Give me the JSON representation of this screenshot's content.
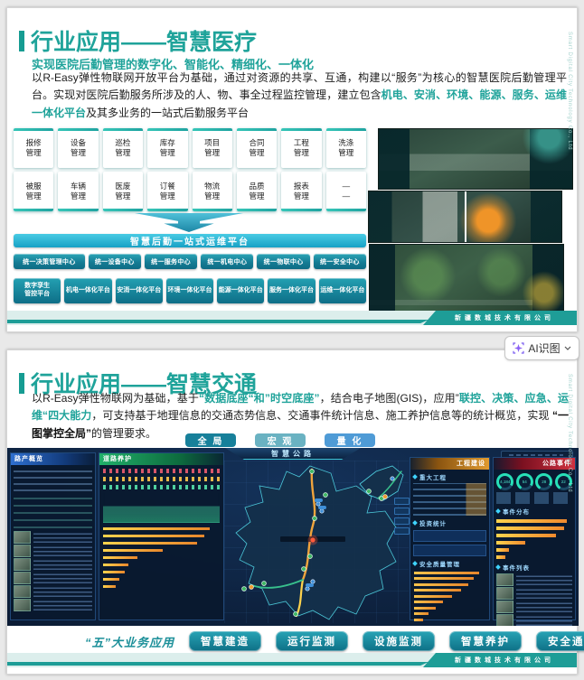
{
  "ai_button": {
    "label": "AI识图"
  },
  "footer": {
    "company": "新疆数城技术有限公司",
    "side_text": "Smart Digital City Technology Co., Ltd"
  },
  "colors": {
    "accent_teal": "#1fa39a",
    "cyan_bar": "#2cb7d6",
    "button_teal": "#147e96",
    "dashboard_bg": "#0b1c35",
    "header_blue": "#2e6fd0",
    "header_green": "#21b06a",
    "header_orange": "#e09a2e",
    "header_red": "#d0313f"
  },
  "slide1": {
    "title": "行业应用——智慧医疗",
    "subtitle": "实现医院后勤管理的数字化、智能化、精细化、一体化",
    "body": {
      "seg1": "以R-Easy弹性物联网开放平台为基础，通过对资源的共享、互通，构建以“服务”为核心的智慧医院后勤管理平台。实现对医院后勤服务所涉及的人、物、事全过程监控管理，建立包含",
      "hl": "机电、安消、环境、能源、服务、运维一体化平台",
      "seg2": "及其多业务的一站式后勤服务平台"
    },
    "modules": {
      "row1": [
        {
          "l1": "报修",
          "l2": "管理"
        },
        {
          "l1": "设备",
          "l2": "管理"
        },
        {
          "l1": "巡检",
          "l2": "管理"
        },
        {
          "l1": "库存",
          "l2": "管理"
        },
        {
          "l1": "项目",
          "l2": "管理"
        },
        {
          "l1": "合同",
          "l2": "管理"
        },
        {
          "l1": "工程",
          "l2": "管理"
        },
        {
          "l1": "洗涤",
          "l2": "管理"
        }
      ],
      "row2": [
        {
          "l1": "被服",
          "l2": "管理"
        },
        {
          "l1": "车辆",
          "l2": "管理"
        },
        {
          "l1": "医废",
          "l2": "管理"
        },
        {
          "l1": "订餐",
          "l2": "管理"
        },
        {
          "l1": "物流",
          "l2": "管理"
        },
        {
          "l1": "品质",
          "l2": "管理"
        },
        {
          "l1": "报表",
          "l2": "管理"
        },
        {
          "l1": "—",
          "l2": "—"
        }
      ]
    },
    "funnel_bar": "智慧后勤一站式运维平台",
    "centers": [
      "统一决策管理中心",
      "统一设备中心",
      "统一服务中心",
      "统一机电中心",
      "统一物联中心",
      "统一安全中心"
    ],
    "platforms": [
      {
        "l1": "数字孪生",
        "l2": "管控平台"
      },
      {
        "l1": "机电一体化平台",
        "l2": ""
      },
      {
        "l1": "安消一体化平台",
        "l2": ""
      },
      {
        "l1": "环境一体化平台",
        "l2": ""
      },
      {
        "l1": "能源一体化平台",
        "l2": ""
      },
      {
        "l1": "服务一体化平台",
        "l2": ""
      },
      {
        "l1": "运维一体化平台",
        "l2": ""
      }
    ]
  },
  "slide2": {
    "title": "行业应用——智慧交通",
    "body": {
      "seg1": "以R-Easy弹性物联网为基础，基于",
      "hl1": "“数据底座“和”时空底座”",
      "seg2": "，结合电子地图(GIS)，应用”",
      "hl2": "联控、决策、应急、运维“四大能力",
      "seg3": "，可支持基于地理信息的交通态势信息、交通事件统计信息、施工养护信息等的统计概览，实现 ",
      "hl3": "“一图掌控全局”",
      "seg4": "的管理要求。"
    },
    "view_buttons": [
      "全 局",
      "宏 观",
      "量 化"
    ],
    "dashboard": {
      "title": "智慧公路",
      "panel_left1": "路产概览",
      "panel_left2": "道路养护",
      "panel_right1": "工程建设",
      "panel_right2": "公路事件",
      "sections_r1": [
        "重大工程",
        "投资统计",
        "安全质量管理"
      ],
      "sections_r2": [
        "事件分布",
        "事件列表"
      ],
      "gauges": [
        "4,184",
        "54",
        "28",
        "22"
      ]
    },
    "biz_label": "“五”大业务应用",
    "biz_buttons": [
      "智慧建造",
      "运行监测",
      "设施监测",
      "智慧养护",
      "安全通行服务"
    ]
  }
}
